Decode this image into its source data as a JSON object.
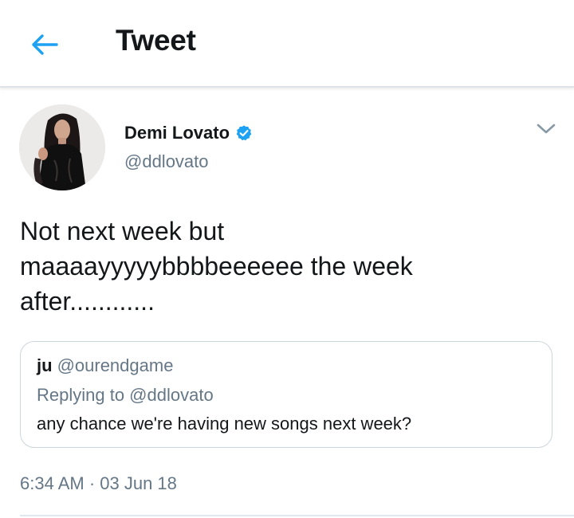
{
  "header": {
    "title": "Tweet",
    "back_icon": "arrow-left-icon",
    "accent_color": "#1da1f2"
  },
  "tweet": {
    "author": {
      "display_name": "Demi Lovato",
      "handle": "@ddlovato",
      "verified": true,
      "verified_icon": "verified-badge-icon",
      "verified_color": "#1da1f2"
    },
    "menu_icon": "chevron-down-icon",
    "text": "Not next week but\nmaaaayyyyybbbbeeeeee the week\nafter............",
    "quoted": {
      "author_name": "ju",
      "author_handle": "@ourendgame",
      "replying_to": "Replying to @ddlovato",
      "text": "any chance we're having new songs next week?"
    },
    "timestamp": "6:34 AM · 03 Jun 18"
  }
}
